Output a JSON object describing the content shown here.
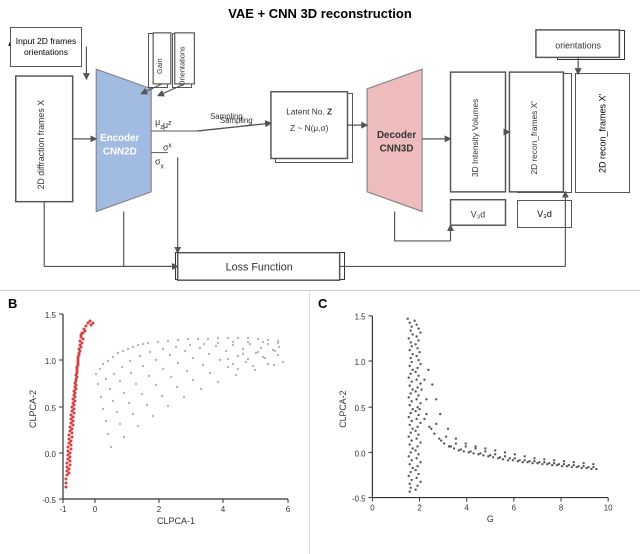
{
  "title": "VAE + CNN 3D reconstruction",
  "section_a_label": "A",
  "section_b_label": "B",
  "section_c_label": "C",
  "boxes": {
    "input_frames": "Input 2D frames\norientations",
    "diffraction_frames": "2D diffraction frames X",
    "gain": "Gain",
    "orientations_top": "Orientations",
    "encoder_label": "Encoder\nCNN2D",
    "mu_label": "μz",
    "sigma_label": "σx",
    "sampling_label": "Sampling",
    "latent_label": "Latent No. Z\nZ ~ N(μ,σ)",
    "decoder_label": "Decoder\nCNN3D",
    "intensity_volumes": "3D Intensity Volumes",
    "recon_frames": "2D recon_frames X'",
    "v3d": "V₃d",
    "orientations_right": "orientations",
    "loss_function": "Loss Function"
  },
  "chart_b": {
    "x_label": "CLPCA-1",
    "y_label": "CLPCA-2",
    "x_min": -1,
    "x_max": 6,
    "y_min": -0.5,
    "y_max": 1.5,
    "x_ticks": [
      -1,
      0,
      2,
      4,
      6
    ],
    "y_ticks": [
      -0.5,
      0.0,
      0.5,
      1.0,
      1.5
    ]
  },
  "chart_c": {
    "x_label": "G",
    "y_label": "CLPCA-2",
    "x_min": 0,
    "x_max": 10,
    "y_min": -0.5,
    "y_max": 1.5,
    "x_ticks": [
      0,
      2,
      4,
      6,
      8,
      10
    ],
    "y_ticks": [
      -0.5,
      0.0,
      0.5,
      1.0,
      1.5
    ]
  }
}
